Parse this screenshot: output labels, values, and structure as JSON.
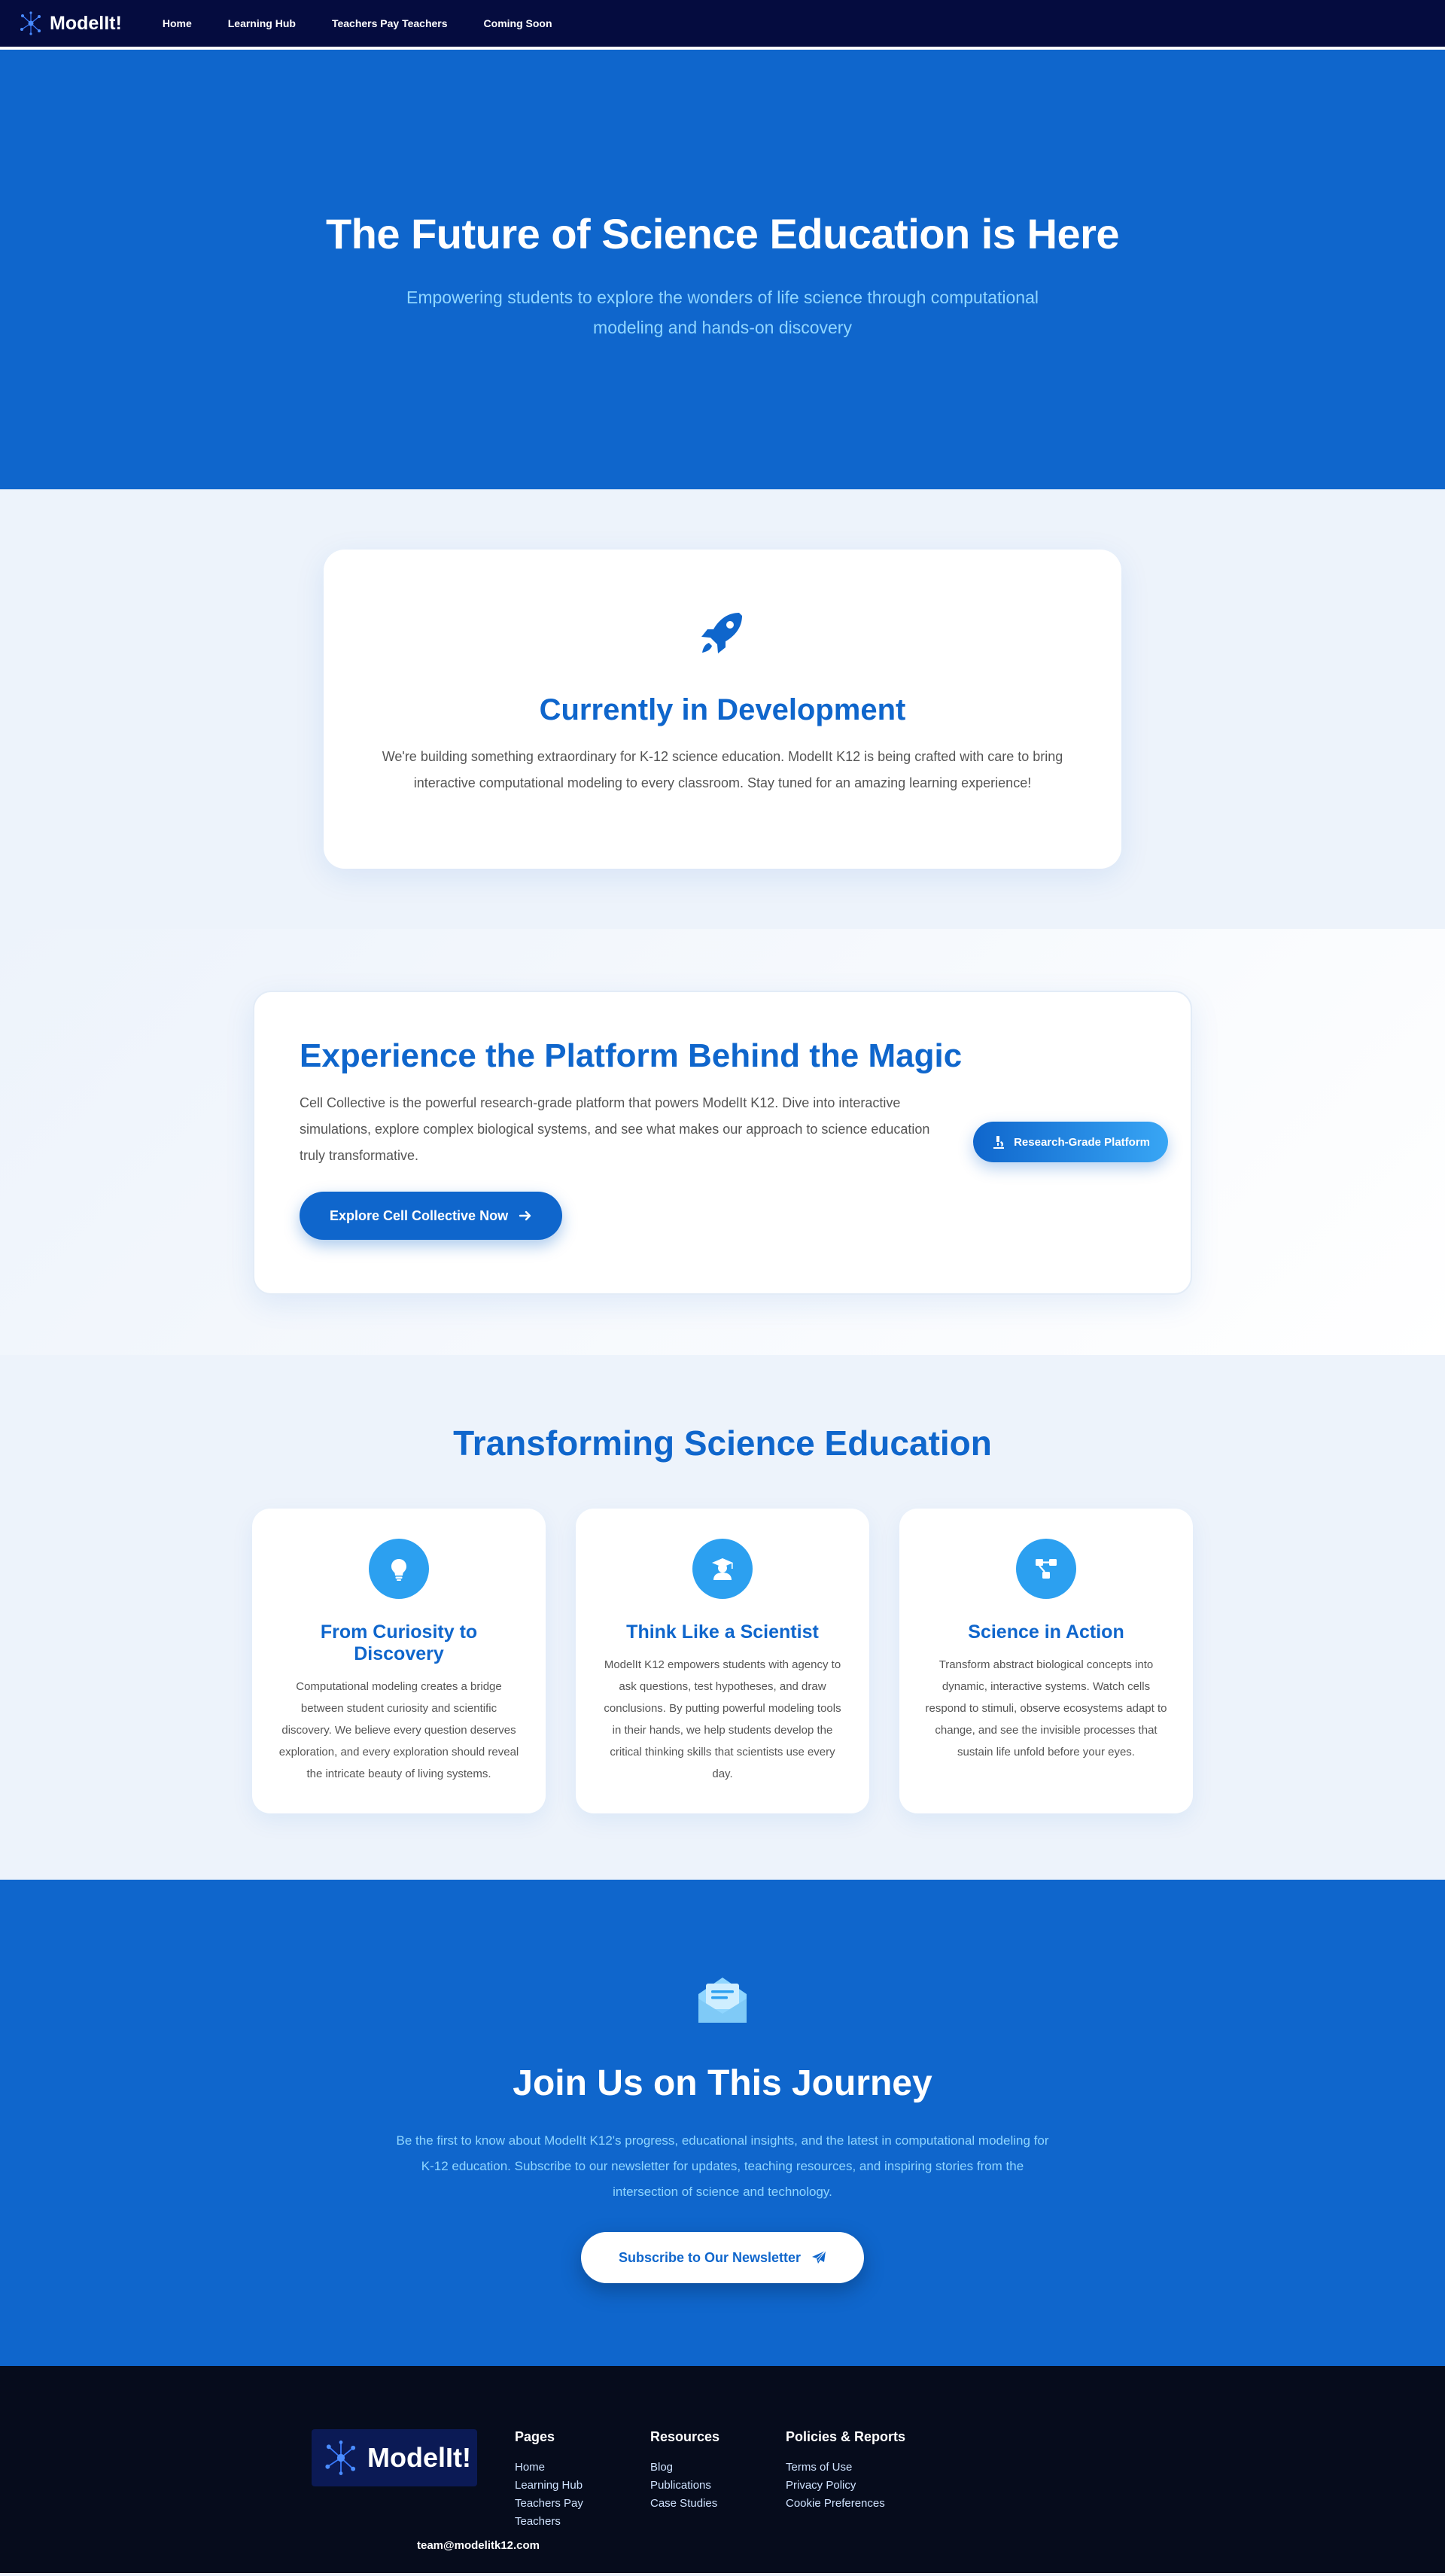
{
  "nav": {
    "brand": "ModelIt!",
    "links": [
      "Home",
      "Learning Hub",
      "Teachers Pay Teachers",
      "Coming Soon"
    ]
  },
  "hero": {
    "title": "The Future of Science Education is Here",
    "subtitle": "Empowering students to explore the wonders of life science through computational modeling and hands-on discovery"
  },
  "development": {
    "icon": "rocket-icon",
    "title": "Currently in Development",
    "text": "We're building something extraordinary for K-12 science education. ModelIt K12 is being crafted with care to bring interactive computational modeling to every classroom. Stay tuned for an amazing learning experience!"
  },
  "platform": {
    "title": "Experience the Platform Behind the Magic",
    "text": "Cell Collective is the powerful research-grade platform that powers ModelIt K12. Dive into interactive simulations, explore complex biological systems, and see what makes our approach to science education truly transformative.",
    "button_label": "Explore Cell Collective Now",
    "badge_label": "Research-Grade Platform"
  },
  "transforming": {
    "title": "Transforming Science Education",
    "cards": [
      {
        "icon": "lightbulb-icon",
        "title": "From Curiosity to Discovery",
        "text": "Computational modeling creates a bridge between student curiosity and scientific discovery. We believe every question deserves exploration, and every exploration should reveal the intricate beauty of living systems."
      },
      {
        "icon": "graduate-icon",
        "title": "Think Like a Scientist",
        "text": "ModelIt K12 empowers students with agency to ask questions, test hypotheses, and draw conclusions. By putting powerful modeling tools in their hands, we help students develop the critical thinking skills that scientists use every day."
      },
      {
        "icon": "network-icon",
        "title": "Science in Action",
        "text": "Transform abstract biological concepts into dynamic, interactive systems. Watch cells respond to stimuli, observe ecosystems adapt to change, and see the invisible processes that sustain life unfold before your eyes."
      }
    ]
  },
  "join": {
    "icon": "envelope-icon",
    "title": "Join Us on This Journey",
    "text": "Be the first to know about ModelIt K12's progress, educational insights, and the latest in computational modeling for K-12 education. Subscribe to our newsletter for updates, teaching resources, and inspiring stories from the intersection of science and technology.",
    "button_label": "Subscribe to Our Newsletter"
  },
  "footer": {
    "logo_text": "ModelIt!",
    "pages_heading": "Pages",
    "pages": [
      "Home",
      "Learning Hub",
      "Teachers Pay Teachers"
    ],
    "resources_heading": "Resources",
    "resources": [
      "Blog",
      "Publications",
      "Case Studies"
    ],
    "policies_heading": "Policies & Reports",
    "policies": [
      "Terms of Use",
      "Privacy Policy",
      "Cookie Preferences"
    ],
    "email": "team@modelitk12.com"
  },
  "colors": {
    "navy": "#050c3f",
    "primary": "#0f66cc",
    "light_blue": "#8fd6ff",
    "accent": "#2ca0f0",
    "footer_bg": "#060c1c"
  }
}
